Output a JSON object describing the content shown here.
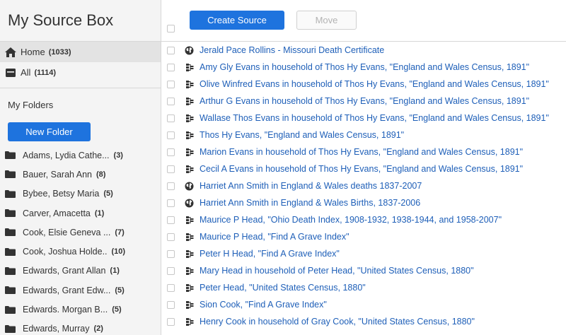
{
  "sidebar": {
    "title": "My Source Box",
    "nav": [
      {
        "label": "Home",
        "count": "(1033)",
        "icon": "home-icon"
      },
      {
        "label": "All",
        "count": "(1114)",
        "icon": "inbox-icon"
      }
    ],
    "folders_heading": "My Folders",
    "new_folder_label": "New Folder",
    "folders": [
      {
        "label": "Adams, Lydia Cathe...",
        "count": "(3)"
      },
      {
        "label": "Bauer, Sarah Ann",
        "count": "(8)"
      },
      {
        "label": "Bybee, Betsy Maria",
        "count": "(5)"
      },
      {
        "label": "Carver, Amacetta",
        "count": "(1)"
      },
      {
        "label": "Cook, Elsie Geneva ...",
        "count": "(7)"
      },
      {
        "label": "Cook, Joshua Holde..",
        "count": "(10)"
      },
      {
        "label": "Edwards, Grant Allan",
        "count": "(1)"
      },
      {
        "label": "Edwards, Grant Edw...",
        "count": "(5)"
      },
      {
        "label": "Edwards. Morgan B...",
        "count": "(5)"
      },
      {
        "label": "Edwards, Murray",
        "count": "(2)"
      }
    ]
  },
  "toolbar": {
    "create_label": "Create Source",
    "move_label": "Move"
  },
  "sources": [
    {
      "title": "Jerald Pace Rollins - Missouri Death Certificate",
      "icon": "globe-icon"
    },
    {
      "title": "Amy Gly Evans in household of Thos Hy Evans, \"England and Wales Census, 1891\"",
      "icon": "tree-icon"
    },
    {
      "title": "Olive Winfred Evans in household of Thos Hy Evans, \"England and Wales Census, 1891\"",
      "icon": "tree-icon"
    },
    {
      "title": "Arthur G Evans in household of Thos Hy Evans, \"England and Wales Census, 1891\"",
      "icon": "tree-icon"
    },
    {
      "title": "Wallase Thos Evans in household of Thos Hy Evans, \"England and Wales Census, 1891\"",
      "icon": "tree-icon"
    },
    {
      "title": "Thos Hy Evans, \"England and Wales Census, 1891\"",
      "icon": "tree-icon"
    },
    {
      "title": "Marion Evans in household of Thos Hy Evans, \"England and Wales Census, 1891\"",
      "icon": "tree-icon"
    },
    {
      "title": "Cecil A Evans in household of Thos Hy Evans, \"England and Wales Census, 1891\"",
      "icon": "tree-icon"
    },
    {
      "title": "Harriet Ann Smith in England & Wales deaths 1837-2007",
      "icon": "globe-icon"
    },
    {
      "title": "Harriet Ann Smith in England & Wales Births, 1837-2006",
      "icon": "globe-icon"
    },
    {
      "title": "Maurice P Head, \"Ohio Death Index, 1908-1932, 1938-1944, and 1958-2007\"",
      "icon": "tree-icon"
    },
    {
      "title": "Maurice P Head, \"Find A Grave Index\"",
      "icon": "tree-icon"
    },
    {
      "title": "Peter H Head, \"Find A Grave Index\"",
      "icon": "tree-icon"
    },
    {
      "title": "Mary Head in household of Peter Head, \"United States Census, 1880\"",
      "icon": "tree-icon"
    },
    {
      "title": "Peter Head, \"United States Census, 1880\"",
      "icon": "tree-icon"
    },
    {
      "title": "Sion Cook, \"Find A Grave Index\"",
      "icon": "tree-icon"
    },
    {
      "title": "Henry Cook in household of Gray Cook, \"United States Census, 1880\"",
      "icon": "tree-icon"
    }
  ],
  "colors": {
    "accent": "#1e73de",
    "link": "#1e5fb8",
    "sidebar_bg": "#f4f4f4"
  }
}
